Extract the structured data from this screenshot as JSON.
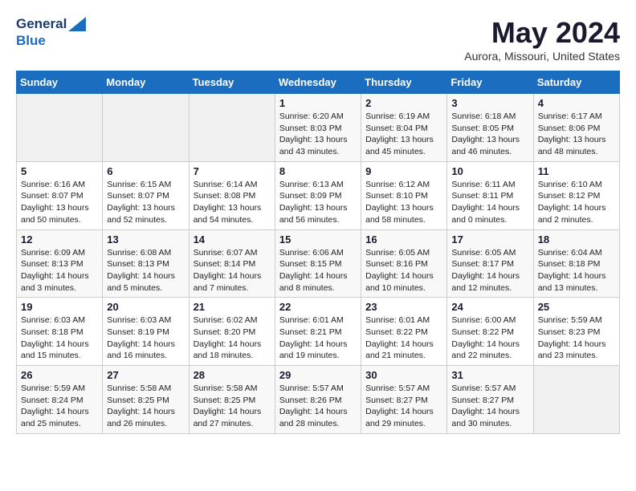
{
  "header": {
    "logo_line1": "General",
    "logo_line2": "Blue",
    "month_year": "May 2024",
    "location": "Aurora, Missouri, United States"
  },
  "weekdays": [
    "Sunday",
    "Monday",
    "Tuesday",
    "Wednesday",
    "Thursday",
    "Friday",
    "Saturday"
  ],
  "weeks": [
    [
      {
        "day": "",
        "info": ""
      },
      {
        "day": "",
        "info": ""
      },
      {
        "day": "",
        "info": ""
      },
      {
        "day": "1",
        "info": "Sunrise: 6:20 AM\nSunset: 8:03 PM\nDaylight: 13 hours\nand 43 minutes."
      },
      {
        "day": "2",
        "info": "Sunrise: 6:19 AM\nSunset: 8:04 PM\nDaylight: 13 hours\nand 45 minutes."
      },
      {
        "day": "3",
        "info": "Sunrise: 6:18 AM\nSunset: 8:05 PM\nDaylight: 13 hours\nand 46 minutes."
      },
      {
        "day": "4",
        "info": "Sunrise: 6:17 AM\nSunset: 8:06 PM\nDaylight: 13 hours\nand 48 minutes."
      }
    ],
    [
      {
        "day": "5",
        "info": "Sunrise: 6:16 AM\nSunset: 8:07 PM\nDaylight: 13 hours\nand 50 minutes."
      },
      {
        "day": "6",
        "info": "Sunrise: 6:15 AM\nSunset: 8:07 PM\nDaylight: 13 hours\nand 52 minutes."
      },
      {
        "day": "7",
        "info": "Sunrise: 6:14 AM\nSunset: 8:08 PM\nDaylight: 13 hours\nand 54 minutes."
      },
      {
        "day": "8",
        "info": "Sunrise: 6:13 AM\nSunset: 8:09 PM\nDaylight: 13 hours\nand 56 minutes."
      },
      {
        "day": "9",
        "info": "Sunrise: 6:12 AM\nSunset: 8:10 PM\nDaylight: 13 hours\nand 58 minutes."
      },
      {
        "day": "10",
        "info": "Sunrise: 6:11 AM\nSunset: 8:11 PM\nDaylight: 14 hours\nand 0 minutes."
      },
      {
        "day": "11",
        "info": "Sunrise: 6:10 AM\nSunset: 8:12 PM\nDaylight: 14 hours\nand 2 minutes."
      }
    ],
    [
      {
        "day": "12",
        "info": "Sunrise: 6:09 AM\nSunset: 8:13 PM\nDaylight: 14 hours\nand 3 minutes."
      },
      {
        "day": "13",
        "info": "Sunrise: 6:08 AM\nSunset: 8:13 PM\nDaylight: 14 hours\nand 5 minutes."
      },
      {
        "day": "14",
        "info": "Sunrise: 6:07 AM\nSunset: 8:14 PM\nDaylight: 14 hours\nand 7 minutes."
      },
      {
        "day": "15",
        "info": "Sunrise: 6:06 AM\nSunset: 8:15 PM\nDaylight: 14 hours\nand 8 minutes."
      },
      {
        "day": "16",
        "info": "Sunrise: 6:05 AM\nSunset: 8:16 PM\nDaylight: 14 hours\nand 10 minutes."
      },
      {
        "day": "17",
        "info": "Sunrise: 6:05 AM\nSunset: 8:17 PM\nDaylight: 14 hours\nand 12 minutes."
      },
      {
        "day": "18",
        "info": "Sunrise: 6:04 AM\nSunset: 8:18 PM\nDaylight: 14 hours\nand 13 minutes."
      }
    ],
    [
      {
        "day": "19",
        "info": "Sunrise: 6:03 AM\nSunset: 8:18 PM\nDaylight: 14 hours\nand 15 minutes."
      },
      {
        "day": "20",
        "info": "Sunrise: 6:03 AM\nSunset: 8:19 PM\nDaylight: 14 hours\nand 16 minutes."
      },
      {
        "day": "21",
        "info": "Sunrise: 6:02 AM\nSunset: 8:20 PM\nDaylight: 14 hours\nand 18 minutes."
      },
      {
        "day": "22",
        "info": "Sunrise: 6:01 AM\nSunset: 8:21 PM\nDaylight: 14 hours\nand 19 minutes."
      },
      {
        "day": "23",
        "info": "Sunrise: 6:01 AM\nSunset: 8:22 PM\nDaylight: 14 hours\nand 21 minutes."
      },
      {
        "day": "24",
        "info": "Sunrise: 6:00 AM\nSunset: 8:22 PM\nDaylight: 14 hours\nand 22 minutes."
      },
      {
        "day": "25",
        "info": "Sunrise: 5:59 AM\nSunset: 8:23 PM\nDaylight: 14 hours\nand 23 minutes."
      }
    ],
    [
      {
        "day": "26",
        "info": "Sunrise: 5:59 AM\nSunset: 8:24 PM\nDaylight: 14 hours\nand 25 minutes."
      },
      {
        "day": "27",
        "info": "Sunrise: 5:58 AM\nSunset: 8:25 PM\nDaylight: 14 hours\nand 26 minutes."
      },
      {
        "day": "28",
        "info": "Sunrise: 5:58 AM\nSunset: 8:25 PM\nDaylight: 14 hours\nand 27 minutes."
      },
      {
        "day": "29",
        "info": "Sunrise: 5:57 AM\nSunset: 8:26 PM\nDaylight: 14 hours\nand 28 minutes."
      },
      {
        "day": "30",
        "info": "Sunrise: 5:57 AM\nSunset: 8:27 PM\nDaylight: 14 hours\nand 29 minutes."
      },
      {
        "day": "31",
        "info": "Sunrise: 5:57 AM\nSunset: 8:27 PM\nDaylight: 14 hours\nand 30 minutes."
      },
      {
        "day": "",
        "info": ""
      }
    ]
  ]
}
